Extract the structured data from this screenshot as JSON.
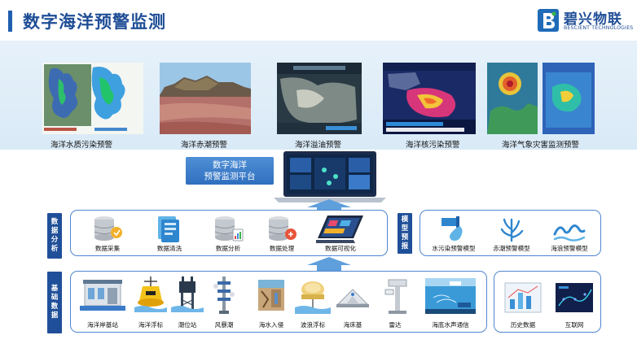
{
  "header": {
    "title": "数字海洋预警监测",
    "logo_name": "碧兴物联",
    "logo_sub": "BESCIENT TECHNOLOGIES"
  },
  "warnings": [
    {
      "label": "海洋水质污染预警",
      "icon": "water-quality-map"
    },
    {
      "label": "海洋赤潮预警",
      "icon": "red-tide-photo"
    },
    {
      "label": "海洋溢油预警",
      "icon": "oil-spill-satellite"
    },
    {
      "label": "海洋核污染预警",
      "icon": "nuclear-pollution-news"
    },
    {
      "label": "海洋气象灾害监测预警",
      "icon": "typhoon-satellite"
    }
  ],
  "platform": {
    "label_line1": "数字海洋",
    "label_line2": "预警监测平台"
  },
  "data_analysis": {
    "tag_chars": [
      "数",
      "据",
      "分",
      "析"
    ],
    "items": [
      {
        "label": "数据采集",
        "icon": "database-collect-icon"
      },
      {
        "label": "数据清洗",
        "icon": "data-clean-icon"
      },
      {
        "label": "数据分析",
        "icon": "database-analyze-icon"
      },
      {
        "label": "数据处理",
        "icon": "database-process-icon"
      },
      {
        "label": "数据可视化",
        "icon": "tablet-visualize-icon"
      }
    ]
  },
  "model_forecast": {
    "tag_chars": [
      "模",
      "型",
      "预",
      "报"
    ],
    "items": [
      {
        "label": "水污染预警模型",
        "icon": "pipe-discharge-icon"
      },
      {
        "label": "赤潮预警模型",
        "icon": "seaweed-icon"
      },
      {
        "label": "海浪预警模型",
        "icon": "wave-icon"
      }
    ]
  },
  "base_data": {
    "tag_chars": [
      "基",
      "础",
      "数",
      "据"
    ],
    "items": [
      {
        "label": "海洋岸基站",
        "icon": "shore-station-icon"
      },
      {
        "label": "海洋浮标",
        "icon": "ocean-buoy-icon"
      },
      {
        "label": "潮位站",
        "icon": "tide-station-icon"
      },
      {
        "label": "风暴潮",
        "icon": "storm-surge-tower-icon"
      },
      {
        "label": "海水入侵",
        "icon": "seawater-intrusion-icon"
      },
      {
        "label": "波浪浮标",
        "icon": "wave-buoy-icon"
      },
      {
        "label": "海床基",
        "icon": "seabed-base-icon"
      },
      {
        "label": "雷达",
        "icon": "radar-icon"
      },
      {
        "label": "海底水声通信",
        "icon": "underwater-acoustic-icon"
      }
    ],
    "extra": [
      {
        "label": "历史数据",
        "icon": "history-data-icon"
      },
      {
        "label": "互联网",
        "icon": "internet-icon"
      }
    ]
  },
  "colors": {
    "brand": "#1f4e96",
    "tag_bg": "#1f4f98",
    "panel_border": "#4f86cf",
    "band_bg": "#dcecf8",
    "arrow": "#5e9fdc"
  }
}
